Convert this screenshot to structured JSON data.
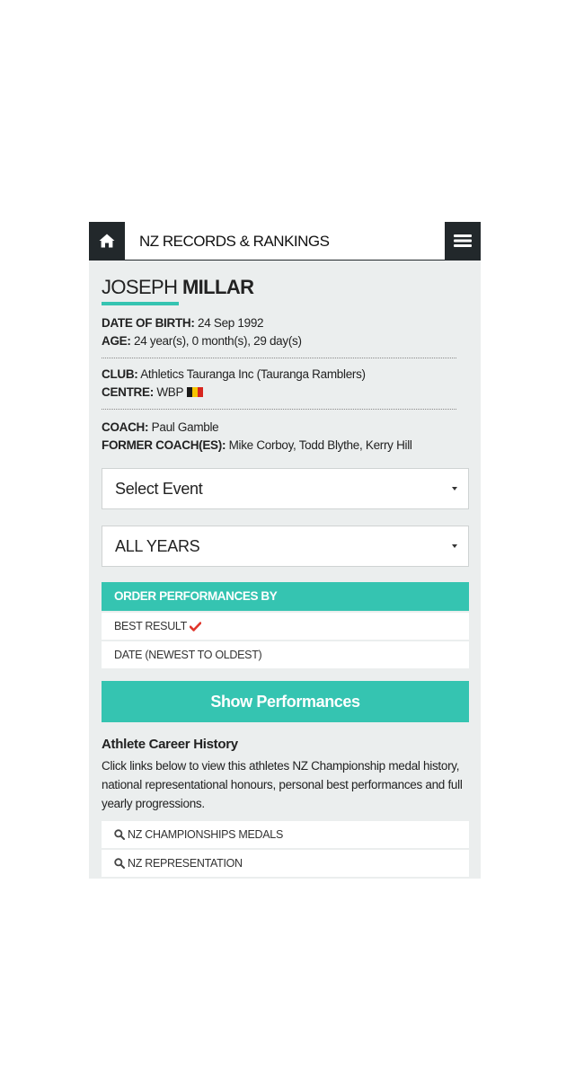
{
  "header": {
    "title": "NZ RECORDS & RANKINGS",
    "home_icon": "home-icon",
    "menu_icon": "hamburger-menu-icon"
  },
  "athlete": {
    "first_name": "JOSEPH",
    "last_name": "MILLAR",
    "dob_label": "DATE OF BIRTH:",
    "dob_value": " 24 Sep 1992",
    "age_label": "AGE:",
    "age_value": " 24 year(s), 0 month(s), 29 day(s)",
    "club_label": "CLUB:",
    "club_value": " Athletics Tauranga Inc (Tauranga Ramblers)",
    "centre_label": "CENTRE:",
    "centre_value": " WBP",
    "centre_flag_colors": [
      "#1a1a1a",
      "#f5c400",
      "#d7261e"
    ],
    "coach_label": "COACH:",
    "coach_value": " Paul Gamble",
    "former_coach_label": "FORMER COACH(ES):",
    "former_coach_value": " Mike Corboy, Todd Blythe, Kerry Hill"
  },
  "filters": {
    "event_select": "Select Event",
    "year_select": "ALL YEARS"
  },
  "order": {
    "header": "ORDER PERFORMANCES BY",
    "options": [
      {
        "label": "BEST RESULT",
        "selected": true
      },
      {
        "label": "DATE (NEWEST TO OLDEST)",
        "selected": false
      }
    ],
    "button": "Show Performances"
  },
  "career": {
    "title": "Athlete Career History",
    "description": "Click links below to view this athletes NZ Championship medal history, national representational honours, personal best performances and full yearly progressions.",
    "links": [
      {
        "label": "NZ CHAMPIONSHIPS MEDALS"
      },
      {
        "label": "NZ REPRESENTATION"
      }
    ]
  },
  "colors": {
    "accent": "#35c4b1",
    "dark": "#22282b",
    "check": "#e0352b",
    "panel_bg": "#ebeeee"
  }
}
